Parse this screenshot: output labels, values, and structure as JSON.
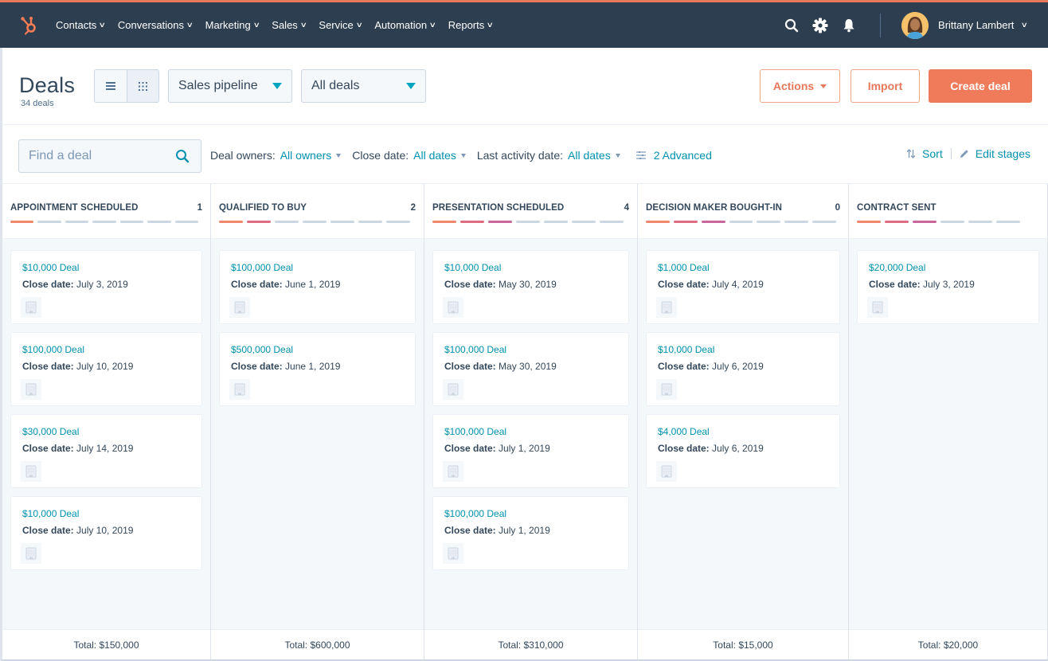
{
  "nav": {
    "items": [
      {
        "label": "Contacts"
      },
      {
        "label": "Conversations"
      },
      {
        "label": "Marketing"
      },
      {
        "label": "Sales"
      },
      {
        "label": "Service"
      },
      {
        "label": "Automation"
      },
      {
        "label": "Reports"
      }
    ],
    "user_name": "Brittany Lambert",
    "icons": [
      "search-icon",
      "gear-icon",
      "bell-icon"
    ],
    "accent_color": "#e8785a",
    "bg_color": "#2d3e50"
  },
  "header": {
    "title": "Deals",
    "subtitle": "34 deals",
    "pipeline_select": "Sales pipeline",
    "view_select": "All deals",
    "actions_label": "Actions",
    "import_label": "Import",
    "create_label": "Create deal"
  },
  "filters": {
    "search_placeholder": "Find a deal",
    "items": [
      {
        "label": "Deal owners:",
        "value": "All owners"
      },
      {
        "label": "Close date:",
        "value": "All dates"
      },
      {
        "label": "Last activity date:",
        "value": "All dates"
      }
    ],
    "advanced_label": "2 Advanced",
    "sort_label": "Sort",
    "edit_stages_label": "Edit stages"
  },
  "stage_colors": {
    "orange": "#f2876b",
    "pink": "#e06a80",
    "magenta": "#c8659a",
    "inactive": "#cbd6e2"
  },
  "columns": [
    {
      "title": "APPOINTMENT SCHEDULED",
      "count": "1",
      "stripes": [
        "orange",
        "inactive",
        "inactive",
        "inactive",
        "inactive",
        "inactive",
        "inactive"
      ],
      "total": "Total: $150,000",
      "cards": [
        {
          "amount": "$10,000 Deal",
          "date_label": "Close date:",
          "date": "July 3, 2019"
        },
        {
          "amount": "$100,000 Deal",
          "date_label": "Close date:",
          "date": "July 10, 2019"
        },
        {
          "amount": "$30,000 Deal",
          "date_label": "Close date:",
          "date": "July 14, 2019"
        },
        {
          "amount": "$10,000 Deal",
          "date_label": "Close date:",
          "date": "July 10, 2019"
        }
      ]
    },
    {
      "title": "QUALIFIED TO BUY",
      "count": "2",
      "stripes": [
        "orange",
        "pink",
        "inactive",
        "inactive",
        "inactive",
        "inactive",
        "inactive"
      ],
      "total": "Total: $600,000",
      "cards": [
        {
          "amount": "$100,000 Deal",
          "date_label": "Close date:",
          "date": "June 1, 2019"
        },
        {
          "amount": "$500,000 Deal",
          "date_label": "Close date:",
          "date": "June 1, 2019"
        }
      ]
    },
    {
      "title": "PRESENTATION SCHEDULED",
      "count": "4",
      "stripes": [
        "orange",
        "pink",
        "magenta",
        "inactive",
        "inactive",
        "inactive",
        "inactive"
      ],
      "total": "Total: $310,000",
      "cards": [
        {
          "amount": "$10,000 Deal",
          "date_label": "Close date:",
          "date": "May 30, 2019"
        },
        {
          "amount": "$100,000 Deal",
          "date_label": "Close date:",
          "date": "May 30, 2019"
        },
        {
          "amount": "$100,000 Deal",
          "date_label": "Close date:",
          "date": "July 1, 2019"
        },
        {
          "amount": "$100,000 Deal",
          "date_label": "Close date:",
          "date": "July 1, 2019"
        }
      ]
    },
    {
      "title": "DECISION MAKER BOUGHT-IN",
      "count": "0",
      "stripes": [
        "orange",
        "pink",
        "magenta",
        "inactive",
        "inactive",
        "inactive",
        "inactive"
      ],
      "total": "Total: $15,000",
      "cards": [
        {
          "amount": "$1,000 Deal",
          "date_label": "Close date:",
          "date": "July 4, 2019"
        },
        {
          "amount": "$10,000 Deal",
          "date_label": "Close date:",
          "date": "July 6, 2019"
        },
        {
          "amount": "$4,000 Deal",
          "date_label": "Close date:",
          "date": "July 6, 2019"
        }
      ]
    },
    {
      "title": "CONTRACT SENT",
      "count": "",
      "stripes": [
        "orange",
        "pink",
        "magenta",
        "inactive",
        "inactive",
        "inactive"
      ],
      "total": "Total: $20,000",
      "cards": [
        {
          "amount": "$20,000 Deal",
          "date_label": "Close date:",
          "date": "July 3, 2019"
        }
      ]
    }
  ]
}
